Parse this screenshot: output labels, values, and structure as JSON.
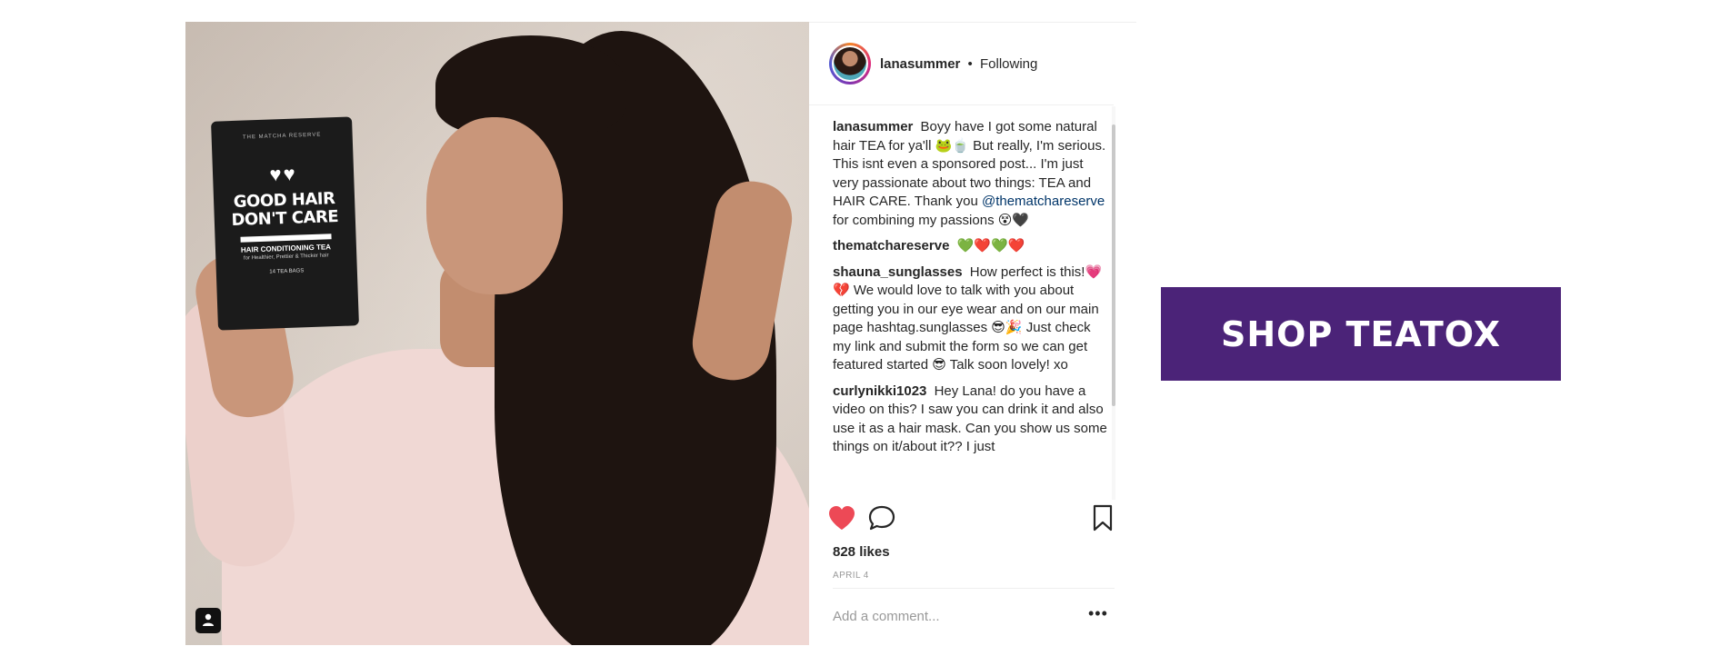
{
  "post": {
    "username": "lanasummer",
    "follow_status": "Following",
    "separator": "•",
    "comments": [
      {
        "user": "lanasummer",
        "text_before": "Boyy have I got some natural hair TEA for ya'll 🐸🍵 But really, I'm serious. This isnt even a sponsored post... I'm just very passionate about two things: TEA and HAIR CARE. Thank you",
        "mention": "@thematchareserve",
        "text_after": "for combining my passions 😵🖤"
      },
      {
        "user": "thematchareserve",
        "text_before": "💚❤️💚❤️",
        "mention": "",
        "text_after": ""
      },
      {
        "user": "shauna_sunglasses",
        "text_before": "How perfect is this!💗💔 We would love to talk with you about getting you in our eye wear and on our main page hashtag.sunglasses 😎🎉 Just check my link and submit the form so we can get featured started 😎 Talk soon lovely! xo",
        "mention": "",
        "text_after": ""
      },
      {
        "user": "curlynikki1023",
        "text_before": "Hey Lana! do you have a video on this? I saw you can drink it and also use it as a hair mask. Can you show us some things on it/about it?? I just",
        "mention": "",
        "text_after": ""
      }
    ],
    "likes": "828 likes",
    "date": "APRIL 4",
    "comment_placeholder": "Add a comment...",
    "more_label": "•••",
    "liked": true
  },
  "product": {
    "brand": "THE MATCHA RESERVE",
    "hearts": "♥♥",
    "headline_line1": "GOOD HAIR",
    "headline_line2": "DON'T CARE",
    "subline": "HAIR CONDITIONING TEA",
    "tiny": "for Healthier, Prettier & Thicker hair",
    "bags": "14 TEA BAGS"
  },
  "cta": {
    "label": "SHOP TEATOX",
    "color": "#4b2378"
  },
  "icons": {
    "like": "heart-icon",
    "comment": "comment-icon",
    "save": "bookmark-icon",
    "user_tag": "user-tag-icon"
  }
}
